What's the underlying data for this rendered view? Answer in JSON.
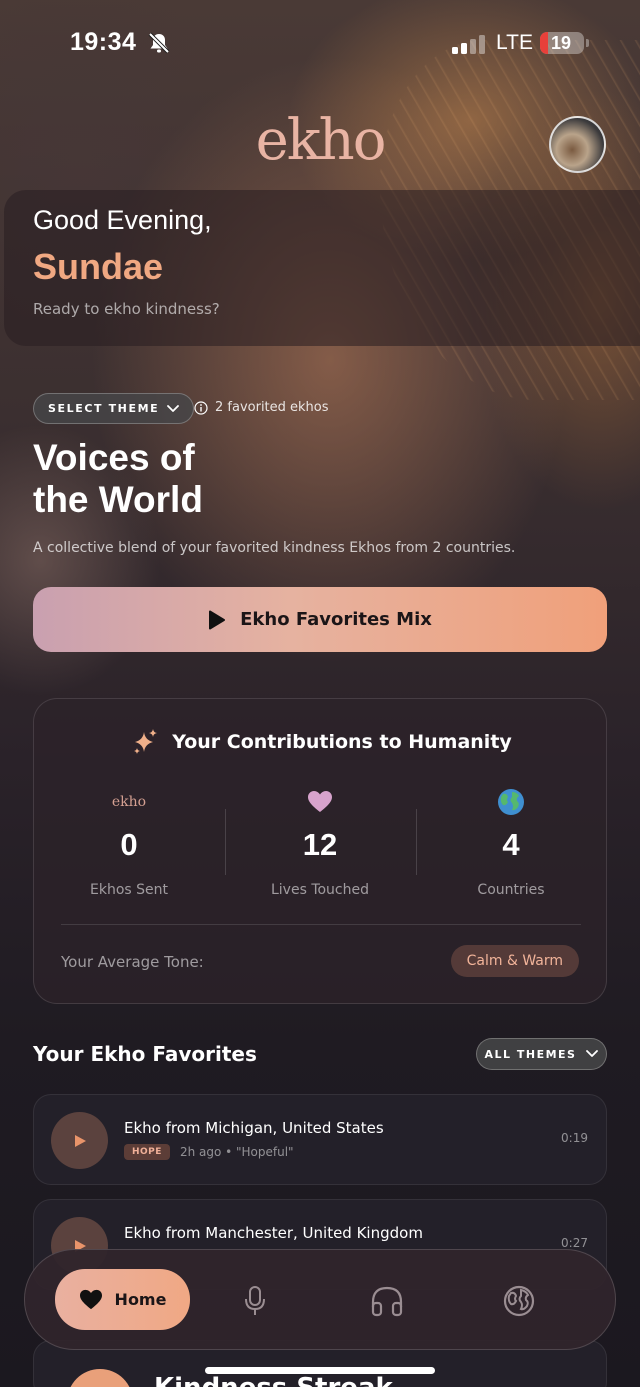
{
  "status_bar": {
    "time": "19:34",
    "network": "LTE",
    "battery": "19",
    "battery_level": 0.19
  },
  "header": {
    "logo": "ekho"
  },
  "greeting": {
    "salutation": "Good Evening,",
    "name": "Sundae",
    "subtitle": "Ready to ekho kindness?"
  },
  "theme": {
    "select_label": "SELECT THEME",
    "favorited_count": "2 favorited ekhos"
  },
  "collection": {
    "title_line1": "Voices of",
    "title_line2": "the World",
    "description": "A collective blend of your favorited kindness Ekhos from 2 countries.",
    "mix_button": "Ekho Favorites Mix"
  },
  "contributions": {
    "title": "Your Contributions to Humanity",
    "stats": [
      {
        "icon": "ekho-logo-icon",
        "icon_text": "ekho",
        "value": "0",
        "label": "Ekhos Sent"
      },
      {
        "icon": "heart-icon",
        "value": "12",
        "label": "Lives Touched"
      },
      {
        "icon": "globe-icon",
        "value": "4",
        "label": "Countries"
      }
    ],
    "tone_label": "Your Average Tone:",
    "tone_value": "Calm & Warm"
  },
  "favorites": {
    "title": "Your Ekho Favorites",
    "filter_label": "ALL THEMES",
    "items": [
      {
        "title": "Ekho from Michigan, United States",
        "tag": "HOPE",
        "meta": "2h ago • \"Hopeful\"",
        "duration": "0:19"
      },
      {
        "title": "Ekho from Manchester, United Kingdom",
        "duration": "0:27"
      }
    ],
    "partial_title": "Kindness Streak"
  },
  "nav": {
    "home_label": "Home",
    "items": [
      "mic-icon",
      "headphones-icon",
      "globe-icon"
    ]
  },
  "colors": {
    "accent": "#f0a882",
    "logo": "#e9b4a4",
    "dark_card": "#24212a"
  }
}
